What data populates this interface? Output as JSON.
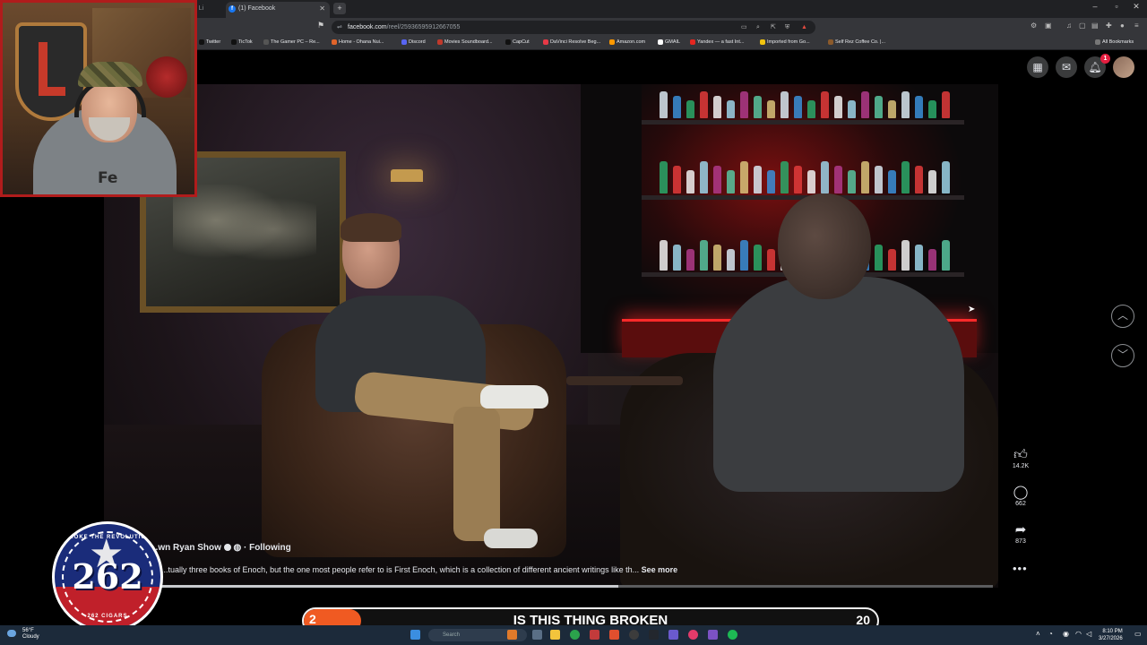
{
  "browser": {
    "inactive_tab_label": "...me - Li",
    "active_tab_label": "(1) Facebook",
    "url_host": "facebook.com",
    "url_path": "/reel/25936595912667055",
    "bookmarks": [
      {
        "label": "Twitter",
        "color": "#111111"
      },
      {
        "label": "TicTok",
        "color": "#111111"
      },
      {
        "label": "The Gamer PC – Re...",
        "color": "#555555"
      },
      {
        "label": "Home - Ohana Nui...",
        "color": "#e0642a"
      },
      {
        "label": "Discord",
        "color": "#5865f2"
      },
      {
        "label": "Movies Soundboard...",
        "color": "#c0392b"
      },
      {
        "label": "CapCut",
        "color": "#111111"
      },
      {
        "label": "DaVinci Resolve Beg...",
        "color": "#e63946"
      },
      {
        "label": "Amazon.com",
        "color": "#ff9900"
      },
      {
        "label": "GMAIL",
        "color": "#ffffff"
      },
      {
        "label": "Yandex — a fast Int...",
        "color": "#e52620"
      },
      {
        "label": "Imported from Go...",
        "color": "#f1c40f"
      },
      {
        "label": "Self Rez Coffee Co. |...",
        "color": "#8b5a2b"
      }
    ],
    "all_bookmarks_label": "All Bookmarks"
  },
  "facebook": {
    "notification_count": "1",
    "reel": {
      "page_name": "...wn Ryan Show",
      "following_label": "Following",
      "caption": "...tually three books of Enoch, but the one most people refer to is First Enoch, which is a collection of different ancient writings like th...",
      "see_more_label": "See more",
      "likes": "14.2K",
      "comments": "662",
      "shares": "873",
      "progress_fraction": 0.55
    }
  },
  "webcam": {
    "shirt_text": "Fe"
  },
  "seal": {
    "number": "262",
    "top_text": "SMOKE THE REVOLUTION",
    "bottom_text": "262 CIGARS"
  },
  "poll": {
    "left_value": "2",
    "title": "IS THIS THING BROKEN",
    "right_value": "20"
  },
  "taskbar": {
    "temperature": "56°F",
    "condition": "Cloudy",
    "search_placeholder": "Search",
    "time": "8:10 PM",
    "date": "3/27/2026"
  }
}
